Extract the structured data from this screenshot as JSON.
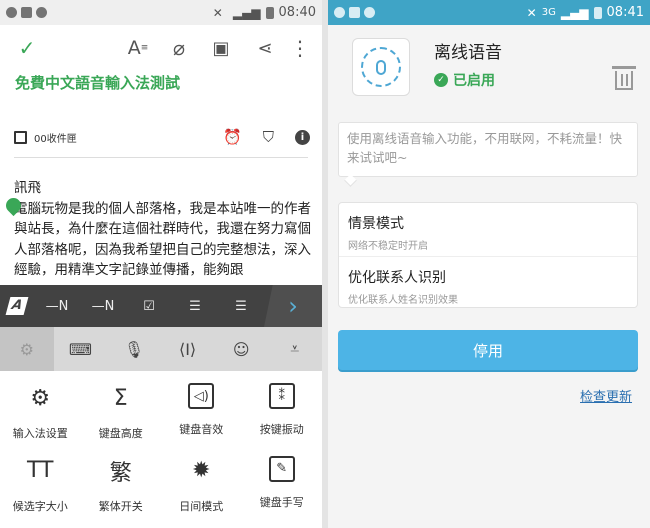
{
  "left": {
    "statusbar": {
      "time": "08:40",
      "network": ""
    },
    "note": {
      "title": "免費中文語音輸入法測試",
      "notebook": "00收件匣",
      "body": "訊飛\n電腦玩物是我的個人部落格，我是本站唯一的作者與站長，為什麼在這個社群時代，我還在努力寫個人部落格呢，因為我希望把自己的完整想法，深入經驗，用精準文字記錄並傳播，能夠跟"
    },
    "keyboard": {
      "logo": "A",
      "toolbar": [
        "—N",
        "—N",
        "☑",
        "☰",
        "☰"
      ],
      "next": "›",
      "bar": [
        "⚙",
        "⌨",
        "🎙",
        "⟨I⟩",
        "☺",
        "⩡"
      ],
      "grid": [
        {
          "icon": "⚙",
          "label": "输入法设置"
        },
        {
          "icon": "Σ",
          "label": "键盘高度"
        },
        {
          "icon": "◁)",
          "label": "键盘音效"
        },
        {
          "icon": "⁑",
          "label": "按键振动"
        },
        {
          "icon": "TT",
          "label": "候选字大小"
        },
        {
          "icon": "繁",
          "label": "繁体开关"
        },
        {
          "icon": "✹",
          "label": "日间模式"
        },
        {
          "icon": "✎",
          "label": "键盘手写"
        }
      ]
    }
  },
  "right": {
    "statusbar": {
      "time": "08:41",
      "network": "3G"
    },
    "title": "离线语音",
    "status": "已启用",
    "description": "使用离线语音输入功能，不用联网，不耗流量！快来试试吧~",
    "options": [
      {
        "title": "情景模式",
        "subtitle": "网络不稳定时开启"
      },
      {
        "title": "优化联系人识别",
        "subtitle": "优化联系人姓名识别效果"
      }
    ],
    "stop_label": "停用",
    "update_label": "检查更新"
  },
  "colors": {
    "accent_green": "#3aa757",
    "accent_blue": "#4db4e6",
    "status_blue": "#3fa4c6"
  }
}
